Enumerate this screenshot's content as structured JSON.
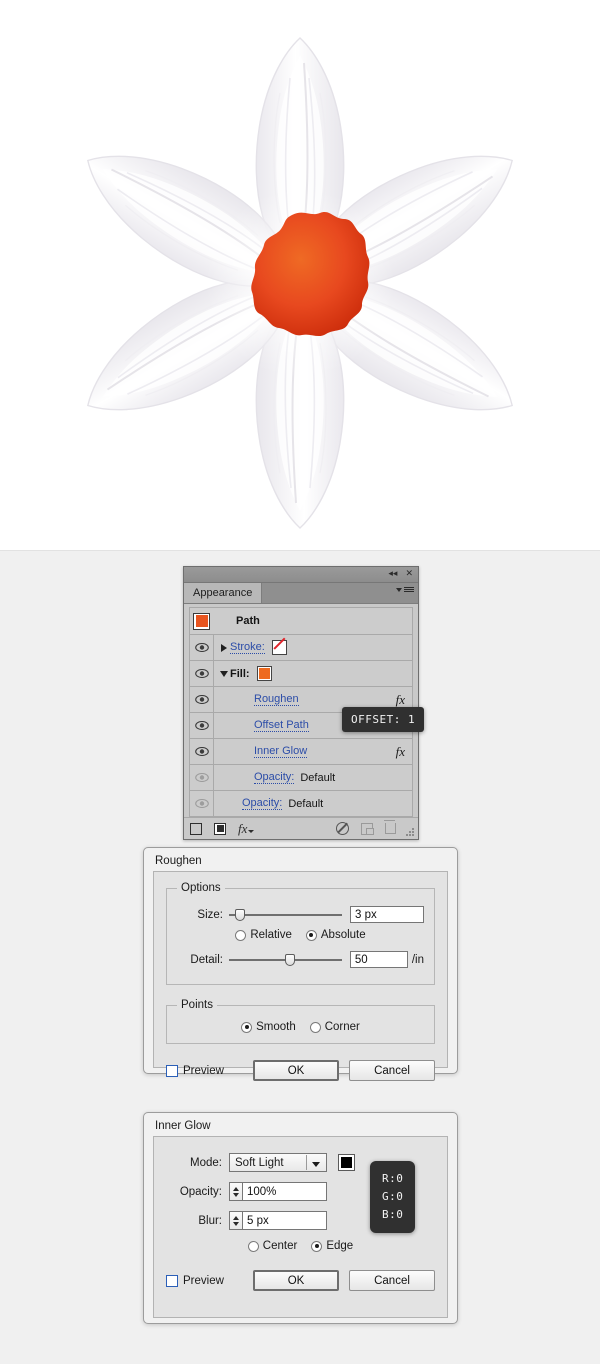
{
  "canvas": {
    "name": "illustration-canvas",
    "description": "White six-petal narcissus flower illustration with roughened orange center",
    "background": "#ffffff",
    "petal_color": "#f2f0f4",
    "center_color": "#e8491f",
    "center_color_dark": "#cf2d0d"
  },
  "appearance_panel": {
    "tab_label": "Appearance",
    "titlebar": {
      "collapse_icon": "double-left-chevron-icon",
      "close_icon": "close-icon",
      "menu_icon": "panel-menu-icon"
    },
    "target": {
      "label": "Path",
      "swatch_color": "#e8541f"
    },
    "rows": [
      {
        "label": "Stroke:",
        "suffix": "",
        "swatch": "none",
        "visible": true,
        "disclosure": "right",
        "fx": false,
        "indent": 0
      },
      {
        "label": "Fill:",
        "suffix": "",
        "swatch": "#ee6a1f",
        "visible": true,
        "disclosure": "down",
        "fx": false,
        "indent": 0
      },
      {
        "label": "Roughen",
        "suffix": "",
        "swatch": null,
        "visible": true,
        "disclosure": "none",
        "fx": true,
        "indent": 2
      },
      {
        "label": "Offset Path",
        "suffix": "",
        "swatch": null,
        "visible": true,
        "disclosure": "none",
        "fx": false,
        "indent": 2
      },
      {
        "label": "Inner Glow",
        "suffix": "",
        "swatch": null,
        "visible": true,
        "disclosure": "none",
        "fx": true,
        "indent": 2
      },
      {
        "label": "Opacity:",
        "suffix": "Default",
        "swatch": null,
        "visible": false,
        "disclosure": "none",
        "fx": false,
        "indent": 2
      },
      {
        "label": "Opacity:",
        "suffix": "Default",
        "swatch": null,
        "visible": false,
        "disclosure": "none",
        "fx": false,
        "indent": 1
      }
    ],
    "footer_icons": [
      "new-fill-icon",
      "new-stroke-icon",
      "add-effect-fx-icon",
      "clear-appearance-icon",
      "duplicate-item-icon",
      "delete-item-icon",
      "resize-grip-icon"
    ]
  },
  "tooltips": {
    "offset": "OFFSET: 1",
    "rgb": "R:0\nG:0\nB:0"
  },
  "roughen_dialog": {
    "title": "Roughen",
    "options_group": "Options",
    "size_label": "Size:",
    "size_value": "3 px",
    "size_slider_percent": 5,
    "size_mode_options": [
      "Relative",
      "Absolute"
    ],
    "size_mode_selected": "Absolute",
    "detail_label": "Detail:",
    "detail_value": "50",
    "detail_unit": "/in",
    "detail_slider_percent": 50,
    "points_group": "Points",
    "points_options": [
      "Smooth",
      "Corner"
    ],
    "points_selected": "Smooth",
    "preview_label": "Preview",
    "preview_checked": false,
    "ok_label": "OK",
    "cancel_label": "Cancel"
  },
  "inner_glow_dialog": {
    "title": "Inner Glow",
    "mode_label": "Mode:",
    "mode_value": "Soft Light",
    "mode_color": "#000000",
    "opacity_label": "Opacity:",
    "opacity_value": "100%",
    "blur_label": "Blur:",
    "blur_value": "5 px",
    "position_options": [
      "Center",
      "Edge"
    ],
    "position_selected": "Edge",
    "preview_label": "Preview",
    "preview_checked": false,
    "ok_label": "OK",
    "cancel_label": "Cancel"
  }
}
